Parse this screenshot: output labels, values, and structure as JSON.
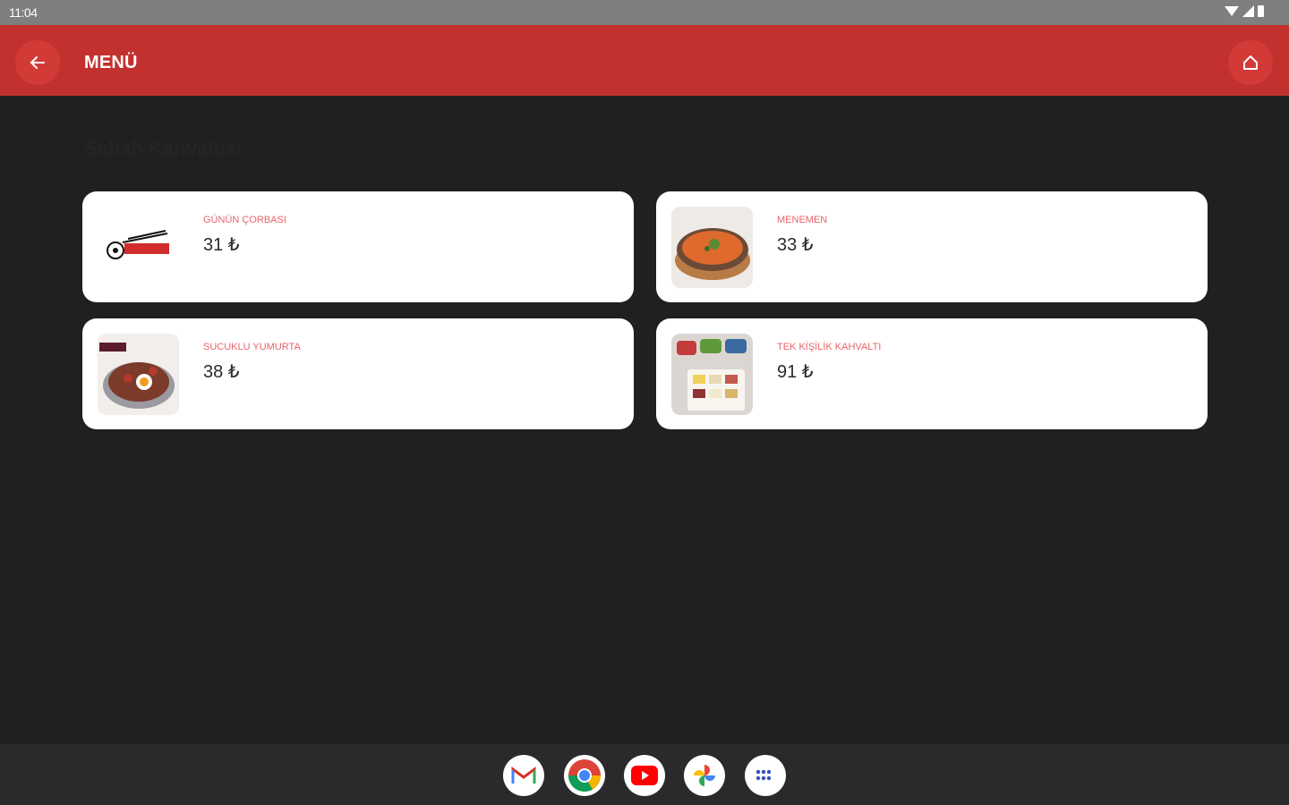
{
  "status_bar": {
    "time": "11:04"
  },
  "app_bar": {
    "title": "MENÜ"
  },
  "section": {
    "title": "Sabah Kahvaltısı"
  },
  "items": [
    {
      "name": "GÜNÜN ÇORBASI",
      "price": "31 ₺"
    },
    {
      "name": "MENEMEN",
      "price": "33 ₺"
    },
    {
      "name": "SUCUKLU YUMURTA",
      "price": "38 ₺"
    },
    {
      "name": "TEK KİŞİLİK KAHVALTI",
      "price": "91 ₺"
    }
  ],
  "dock": [
    "gmail-icon",
    "chrome-icon",
    "youtube-icon",
    "photos-icon",
    "app-drawer-icon"
  ],
  "colors": {
    "accent": "#c3312e",
    "background": "#212021",
    "item_name": "#e8646a"
  }
}
